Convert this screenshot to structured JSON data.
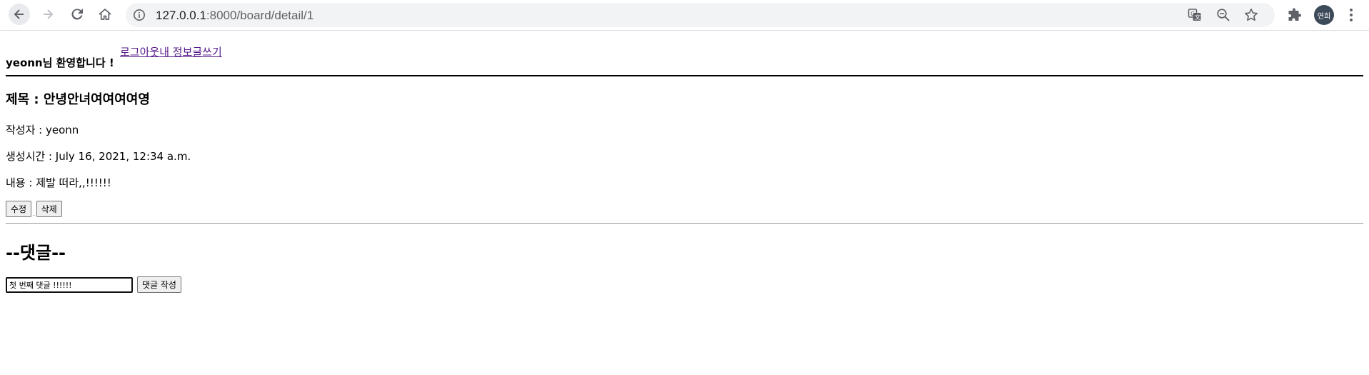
{
  "browser": {
    "url_host": "127.0.0.1",
    "url_path": ":8000/board/detail/1",
    "profile_label": "연희",
    "icons": [
      "back-arrow-icon",
      "forward-arrow-icon",
      "reload-icon",
      "home-icon",
      "info-icon",
      "translate-icon",
      "zoom-icon",
      "star-icon",
      "extensions-icon",
      "menu-icon"
    ]
  },
  "header": {
    "welcome": "yeonn님 환영합니다 !",
    "logout_label": "로그아웃",
    "myinfo_label": "내 정보",
    "write_label": "글쓰기"
  },
  "post": {
    "title": "제목 : 안녕안녀여여여여영",
    "author": "작성자 : yeonn",
    "created": "생성시간 : July 16, 2021, 12:34 a.m.",
    "content": "내용 : 제발 떠라,,!!!!!!",
    "edit_label": "수정",
    "delete_label": "삭제",
    "button_separator": "."
  },
  "comments": {
    "heading": "--댓글--",
    "input_value": "첫 번째 댓글 !!!!!!",
    "submit_label": "댓글 작성"
  },
  "colors": {
    "link_visited": "#551a8b",
    "omnibox_bg": "#f1f3f4",
    "avatar_bg": "#3c4a5a"
  }
}
